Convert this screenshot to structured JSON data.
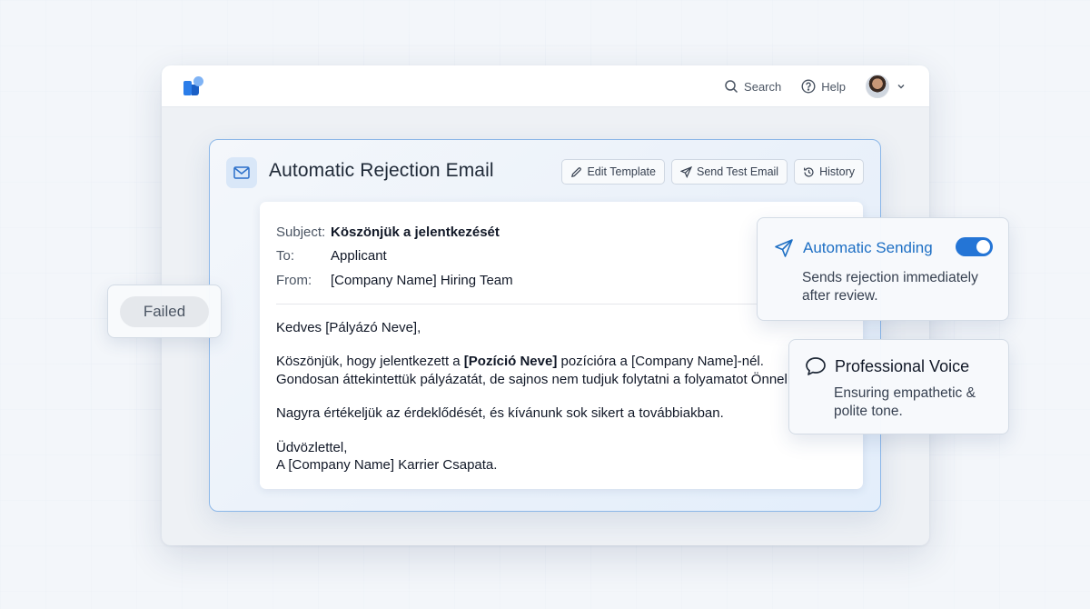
{
  "topbar": {
    "search_label": "Search",
    "help_label": "Help"
  },
  "email_panel": {
    "title": "Automatic Rejection Email",
    "actions": {
      "edit_template": "Edit Template",
      "send_test_email": "Send Test Email",
      "history": "History"
    }
  },
  "email": {
    "subject_label": "Subject:",
    "subject_value": "Köszönjük a jelentkezését",
    "to_label": "To:",
    "to_value": "Applicant",
    "from_label": "From:",
    "from_value": "[Company Name] Hiring Team",
    "greeting": "Kedves [Pályázó Neve],",
    "p1_before": "Köszönjük, hogy jelentkezett a ",
    "p1_bold": "[Pozíció Neve]",
    "p1_after": " pozícióra a [Company Name]-nél.",
    "p1_line2": "Gondosan áttekintettük pályázatát, de sajnos nem tudjuk folytatni a folyamatot Önnel.",
    "p2": "Nagyra értékeljük az érdeklődését, és kívánunk sok sikert a továbbiakban.",
    "closing": "Üdvözlettel,",
    "signature": "A [Company Name] Karrier Csapata."
  },
  "status_badge": {
    "label": "Failed"
  },
  "automatic_sending": {
    "title": "Automatic Sending",
    "description": "Sends rejection immediately after review.",
    "enabled": true
  },
  "professional_voice": {
    "title": "Professional Voice",
    "description": "Ensuring empathetic & polite tone."
  },
  "colors": {
    "accent": "#2475d6",
    "accent_text": "#1d6fc4",
    "card_border": "#8bb7e8"
  },
  "icons": [
    "logo-icon",
    "search-icon",
    "help-icon",
    "avatar",
    "chevron-down-icon",
    "mail-icon",
    "pencil-icon",
    "send-icon",
    "history-icon",
    "paper-plane-icon",
    "speech-bubble-icon"
  ]
}
